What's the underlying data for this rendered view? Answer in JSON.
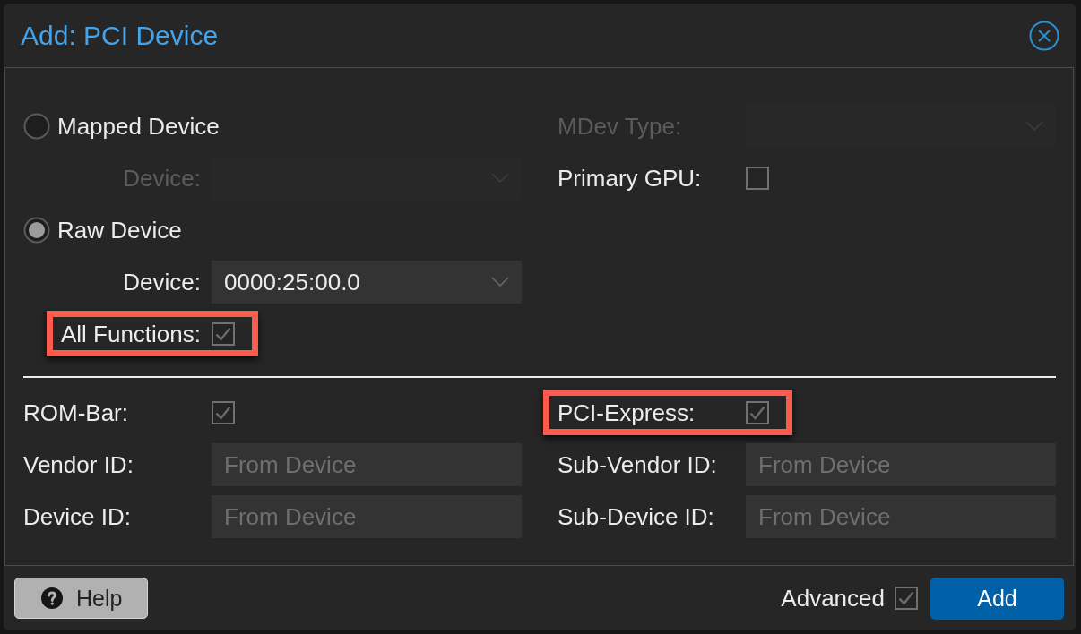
{
  "dialog": {
    "title": "Add: PCI Device"
  },
  "source": [
    {
      "label": "Mapped Device",
      "selected": false,
      "fields": [
        {
          "kind": "select",
          "label": "Device:",
          "disabled": true,
          "highlighted": false
        }
      ]
    },
    {
      "label": "Raw Device",
      "selected": true,
      "fields": [
        {
          "kind": "select",
          "label": "Device:",
          "value": "0000:25:00.0",
          "disabled": false,
          "highlighted": false
        },
        {
          "kind": "checkbox",
          "label": "All Functions:",
          "checked": true,
          "disabled": false,
          "highlighted": true
        }
      ]
    }
  ],
  "mdev_fields": [
    {
      "kind": "select",
      "label": "MDev Type:",
      "disabled": true,
      "highlighted": false
    },
    {
      "kind": "checkbox",
      "label": "Primary GPU:",
      "checked": false,
      "disabled": false,
      "highlighted": false
    }
  ],
  "advanced_left": [
    {
      "kind": "checkbox",
      "label": "ROM-Bar:",
      "checked": true,
      "disabled": false,
      "highlighted": false
    },
    {
      "kind": "text",
      "label": "Vendor ID:",
      "placeholder": "From Device",
      "disabled": false,
      "highlighted": false
    },
    {
      "kind": "text",
      "label": "Device ID:",
      "placeholder": "From Device",
      "disabled": false,
      "highlighted": false
    }
  ],
  "advanced_right": [
    {
      "kind": "checkbox",
      "label": "PCI-Express:",
      "checked": true,
      "disabled": false,
      "highlighted": true
    },
    {
      "kind": "text",
      "label": "Sub-Vendor ID:",
      "placeholder": "From Device",
      "disabled": false,
      "highlighted": false
    },
    {
      "kind": "text",
      "label": "Sub-Device ID:",
      "placeholder": "From Device",
      "disabled": false,
      "highlighted": false
    }
  ],
  "footer": {
    "help_button": "Help",
    "advanced": {
      "label": "Advanced",
      "checked": true
    },
    "add_button": "Add"
  }
}
